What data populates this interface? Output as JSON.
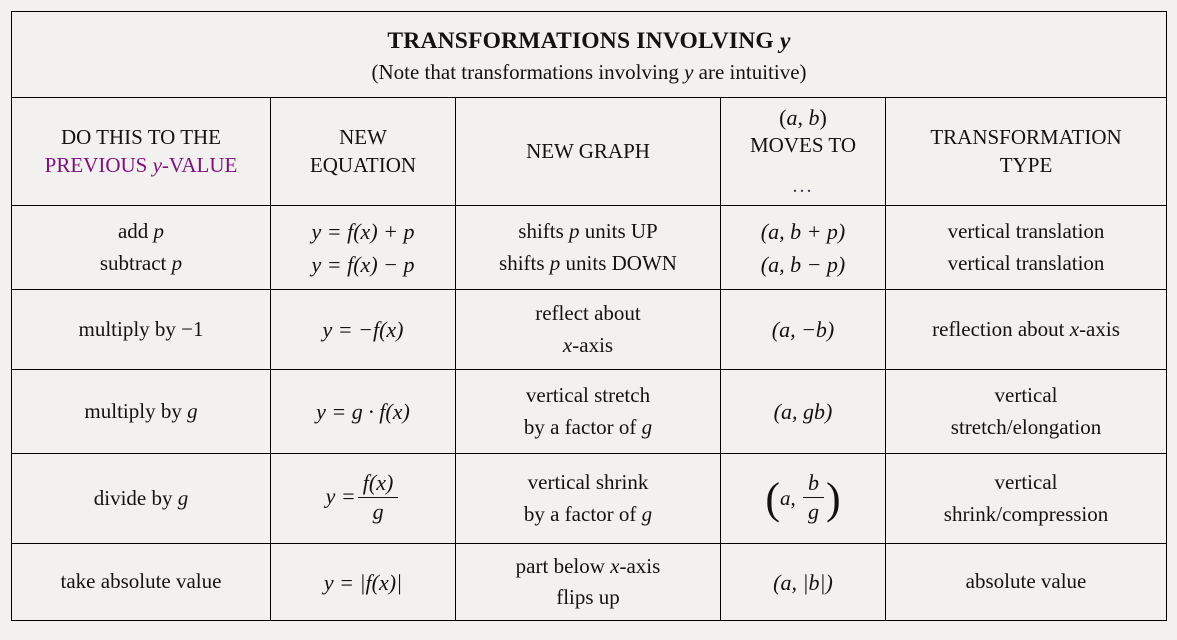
{
  "title": {
    "main_prefix": "TRANSFORMATIONS INVOLVING ",
    "main_var": "y",
    "note_prefix": "(Note that transformations involving ",
    "note_var": "y",
    "note_suffix": " are intuitive)"
  },
  "headers": {
    "col1_line1": "DO THIS TO THE",
    "col1_line2_a": "PREVIOUS ",
    "col1_line2_var": "y",
    "col1_line2_b": "-VALUE",
    "col2_line1": "NEW",
    "col2_line2": "EQUATION",
    "col3_line1": "NEW GRAPH",
    "col4_line1_open": "(",
    "col4_line1_a": "a",
    "col4_line1_comma": ", ",
    "col4_line1_b": "b",
    "col4_line1_close": ")",
    "col4_line2": "MOVES TO",
    "col4_dots": "...",
    "col5_line1": "TRANSFORMATION",
    "col5_line2": "TYPE"
  },
  "rows": [
    {
      "do_line1_text": "add ",
      "do_line1_var": "p",
      "do_line2_text": "subtract ",
      "do_line2_var": "p",
      "eq_line1": "y = f(x) + p",
      "eq_line2": "y = f(x) − p",
      "graph_line1_a": "shifts ",
      "graph_line1_var": "p",
      "graph_line1_b": " units UP",
      "graph_line2_a": "shifts ",
      "graph_line2_var": "p",
      "graph_line2_b": " units DOWN",
      "point_line1": "(a, b + p)",
      "point_line2": "(a, b − p)",
      "type_line1": "vertical translation",
      "type_line2": "vertical translation"
    },
    {
      "do_line1_text": "multiply by ",
      "do_line1_var": "−1",
      "eq_line1": "y = −f(x)",
      "graph_line1_a": "reflect about",
      "graph_line2_var": "x",
      "graph_line2_b": "-axis",
      "point_line1": "(a, −b)",
      "type_line1_a": "reflection about ",
      "type_line1_var": "x",
      "type_line1_b": "-axis"
    },
    {
      "do_line1_text": "multiply by ",
      "do_line1_var": "g",
      "eq_line1": "y = g · f(x)",
      "graph_line1_a": "vertical stretch",
      "graph_line2_a": "by a factor of ",
      "graph_line2_var": "g",
      "point_line1": "(a, gb)",
      "type_line1": "vertical",
      "type_line2": "stretch/elongation"
    },
    {
      "do_line1_text": "divide by ",
      "do_line1_var": "g",
      "eq_numerator": "f(x)",
      "eq_denominator": "g",
      "eq_lhs": "y =",
      "graph_line1_a": "vertical shrink",
      "graph_line2_a": "by a factor of ",
      "graph_line2_var": "g",
      "point_a": "a",
      "point_num": "b",
      "point_den": "g",
      "type_line1": "vertical",
      "type_line2": "shrink/compression"
    },
    {
      "do_line1_text": "take absolute value",
      "eq_line1": "y = |f(x)|",
      "graph_line1_a": "part below ",
      "graph_line1_var": "x",
      "graph_line1_b": "-axis",
      "graph_line2_a": "flips up",
      "point_line1": "(a, |b|)",
      "type_line1": "absolute value"
    }
  ],
  "colors": {
    "purple": "#80107e",
    "background": "#f2f1ef",
    "border": "#000000",
    "text": "#14120f"
  }
}
